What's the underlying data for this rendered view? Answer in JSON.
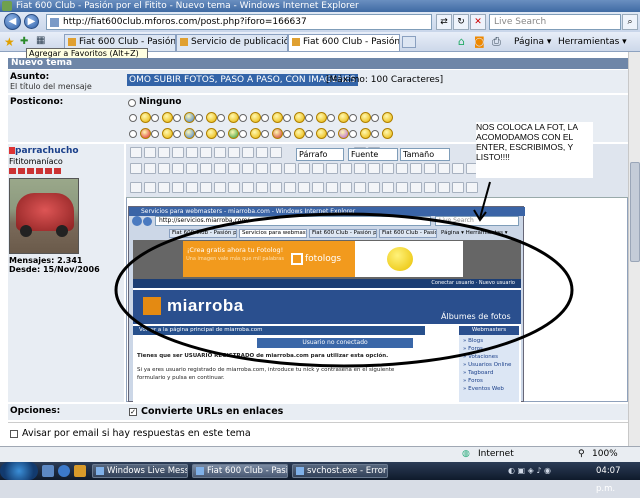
{
  "window": {
    "title": "Fiat 600 Club - Pasión por el Fitito - Nuevo tema - Windows Internet Explorer",
    "url": "http://fiat600club.mforos.com/post.php?iforo=166637",
    "search_placeholder": "Live Search",
    "tooltip": "Agregar a Favoritos (Alt+Z)",
    "tabs": [
      {
        "label": "Fiat 600 Club - Pasión por ..."
      },
      {
        "label": "Servicio de publicación de ..."
      },
      {
        "label": "Fiat 600 Club - Pasión ..."
      }
    ],
    "page_menu": "Página",
    "tools_menu": "Herramientas"
  },
  "form": {
    "section_title": "Nuevo tema",
    "asunto_label": "Asunto:",
    "asunto_sub": "El título del mensaje",
    "asunto_value": "OMO SUBIR FOTOS, PASO A PASO, CON IMAGENES",
    "max_chars": "[Máximo: 100 Caracteres]",
    "posticono_label": "Posticono:",
    "ninguno": "Ninguno",
    "opciones_label": "Opciones:",
    "convert_urls": "Convierte URLs en enlaces",
    "notify": "Avisar por email si hay respuestas en este tema"
  },
  "user": {
    "name": "parrachucho",
    "rank": "Fititomaníaco",
    "messages_label": "Mensajes:",
    "messages_value": "2.341",
    "since_label": "Desde:",
    "since_value": "15/Nov/2006"
  },
  "editor": {
    "paragraph_combo": "Párrafo",
    "font_combo": "Fuente",
    "size_combo": "Tamaño"
  },
  "callout_text": "NOS COLOCA LA FOT, LA ACOMODAMOS CON EL ENTER, ESCRIBIMOS, Y LISTO!!!!",
  "embedded": {
    "title": "Servicios para webmasters - miarroba.com - Windows Internet Explorer",
    "url": "http://servicios.miarroba.com/",
    "search": "Live Search",
    "tabs": [
      "Fiat 600 Club - Pasión por ...",
      "Servicios para webmast...",
      "Fiat 600 Club - Pasión por...",
      "Fiat 600 Club - Pasión p..."
    ],
    "tools": "Página ▾  Herramientas ▾",
    "banner_line1": "¡Crea gratis ahora tu Fotolog!",
    "banner_line2": "Una imagen vale más que mil palabras",
    "fotolog": "fotologs",
    "top_links": "Conectar usuario ·  Nuevo usuario",
    "logo": "miarroba",
    "albums": "Álbumes de fotos",
    "nav": "Volver a la página principal de miarroba.com",
    "not_connected": "Usuario no conectado",
    "text1": "Tienes que ser USUARIO REGISTRADO de miarroba.com para utilizar esta opción.",
    "text2": "Si ya eres usuario registrado de miarroba.com, introduce tu nick y contraseña en el siguiente formulario y pulsa en continuar.",
    "side_title": "Webmasters",
    "side_items": [
      "» Blogs",
      "» Foros",
      "» Votaciones",
      "» Usuarios Online",
      "» Tagboard",
      "» Foros",
      "» Eventos Web"
    ]
  },
  "status": {
    "zone": "Internet",
    "zoom": "100%"
  },
  "taskbar": {
    "items": [
      "Windows Live Mess...",
      "Fiat 600 Club - Pasió...",
      "svchost.exe - Error d..."
    ],
    "clock": "04:07 p.m."
  },
  "colors": {
    "accent": "#3364a8",
    "header": "#6e86a8",
    "callout_ellipse": "#000000"
  }
}
